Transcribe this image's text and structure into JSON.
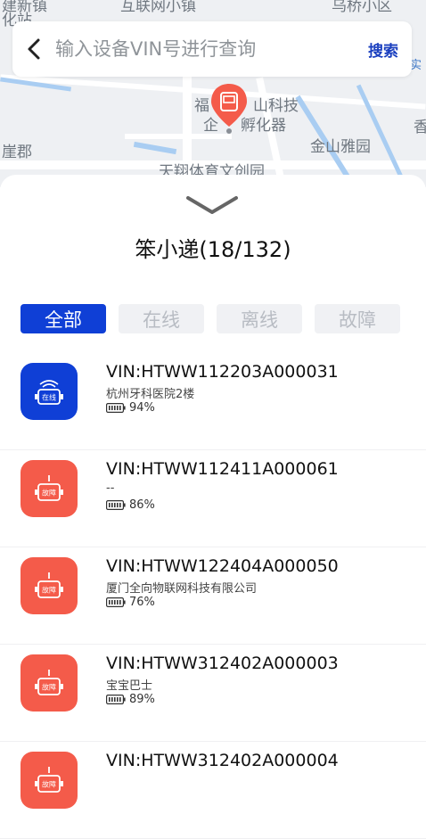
{
  "map": {
    "labels": [
      "建新镇",
      "化站",
      "互联网小镇",
      "乌桥小区",
      "实",
      "福",
      "山科技",
      "企",
      "孵化器",
      "香",
      "金山雅园",
      "崖郡",
      "天翔体育文创园"
    ],
    "colors": {
      "road": "#ffffff",
      "water": "#a9cdf2",
      "pin": "#f45b4a"
    }
  },
  "search": {
    "placeholder": "输入设备VIN号进行查询",
    "value": "",
    "button_label": "搜索"
  },
  "sheet": {
    "title": "笨小递(18/132)"
  },
  "tabs": [
    {
      "label": "全部",
      "active": true
    },
    {
      "label": "在线",
      "active": false
    },
    {
      "label": "离线",
      "active": false
    },
    {
      "label": "故障",
      "active": false
    }
  ],
  "devices": [
    {
      "vin": "VIN:HTWW112203A000031",
      "location": "杭州牙科医院2楼",
      "battery": "94%",
      "status_label": "在线",
      "status": "online"
    },
    {
      "vin": "VIN:HTWW112411A000061",
      "location": "--",
      "battery": "86%",
      "status_label": "故障",
      "status": "fault"
    },
    {
      "vin": "VIN:HTWW122404A000050",
      "location": "厦门全向物联网科技有限公司",
      "battery": "76%",
      "status_label": "故障",
      "status": "fault"
    },
    {
      "vin": "VIN:HTWW312402A000003",
      "location": "宝宝巴士",
      "battery": "89%",
      "status_label": "故障",
      "status": "fault"
    },
    {
      "vin": "VIN:HTWW312402A000004",
      "location": "",
      "battery": "",
      "status_label": "故障",
      "status": "fault"
    }
  ],
  "colors": {
    "accent": "#0f3fd6",
    "fault": "#f45b4a",
    "search_button": "#1a3fbf"
  },
  "icons": {
    "back": "chevron-left-icon",
    "collapse": "chevron-down-icon",
    "device": "robot-icon",
    "battery": "battery-icon"
  }
}
